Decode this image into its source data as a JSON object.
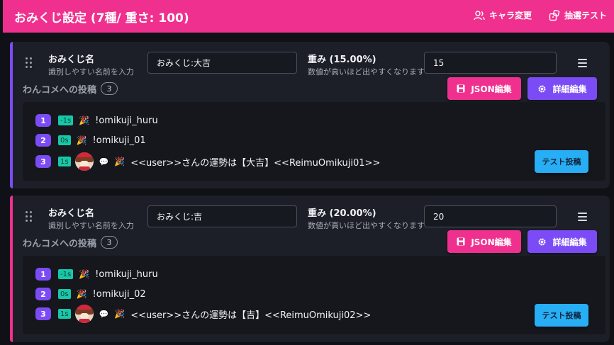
{
  "header": {
    "title": "おみくじ設定 (7種/ 重さ: 100)",
    "chara_label": "キャラ変更",
    "draw_test_label": "抽選テスト"
  },
  "common": {
    "name_label": "おみくじ名",
    "name_help": "識別しやすい名前を入力",
    "weight_help": "数値が高いほど出やすくなります",
    "posts_title": "わんコメへの投稿",
    "json_label": "JSON編集",
    "detail_label": "詳細編集",
    "test_post_label": "テスト投稿"
  },
  "colors": {
    "header_bg": "#f0308e",
    "card1_accent": "#7b4cf5",
    "card2_accent": "#f0308e",
    "delay_badge": "#17c8a8",
    "test_button": "#27aef5"
  },
  "cards": [
    {
      "name_value": "おみくじ:大吉",
      "weight_label": "重み (15.00%)",
      "weight_value": "15",
      "post_count": "3",
      "posts": [
        {
          "num": "1",
          "delay": "-1s",
          "icon": "party-popper-icon",
          "text": "!omikuji_huru"
        },
        {
          "num": "2",
          "delay": "0s",
          "icon": "party-popper-icon",
          "text": "!omikuji_01"
        },
        {
          "num": "3",
          "delay": "1s",
          "icon": "party-popper-icon",
          "text": "<<user>>さんの運勢は【大吉】<<ReimuOmikuji01>>"
        }
      ]
    },
    {
      "name_value": "おみくじ:吉",
      "weight_label": "重み (20.00%)",
      "weight_value": "20",
      "post_count": "3",
      "posts": [
        {
          "num": "1",
          "delay": "-1s",
          "icon": "party-popper-icon",
          "text": "!omikuji_huru"
        },
        {
          "num": "2",
          "delay": "0s",
          "icon": "party-popper-icon",
          "text": "!omikuji_02"
        },
        {
          "num": "3",
          "delay": "1s",
          "icon": "party-popper-icon",
          "text": "<<user>>さんの運勢は【吉】<<ReimuOmikuji02>>"
        }
      ]
    }
  ]
}
